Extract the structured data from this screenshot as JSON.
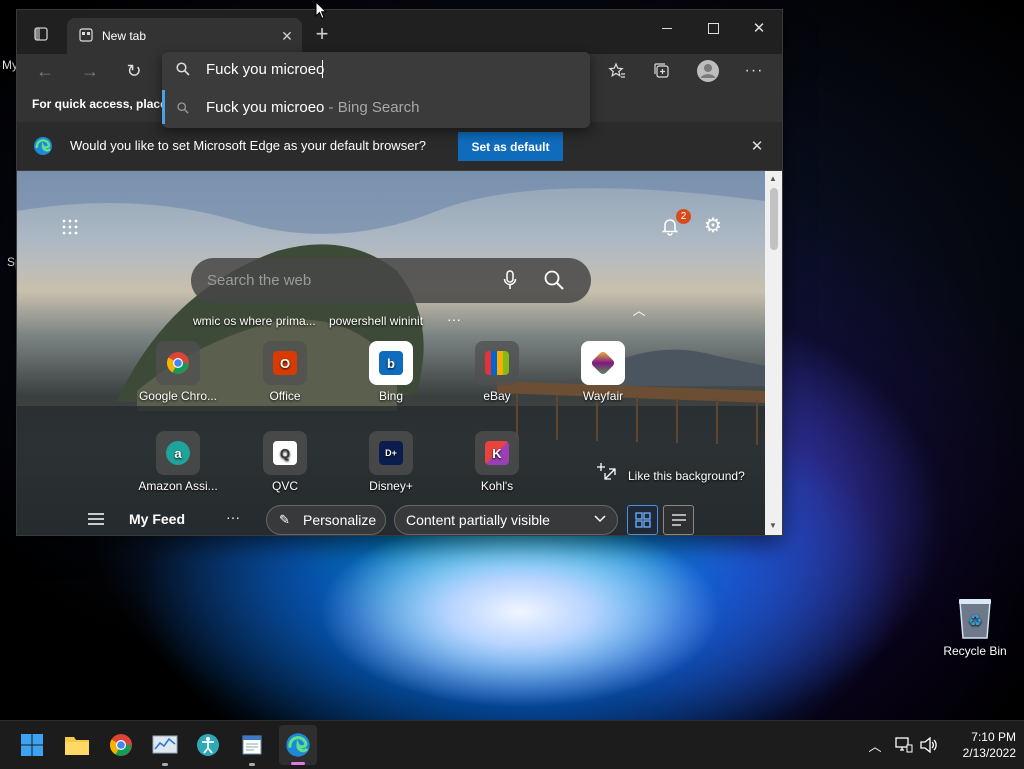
{
  "desktop": {
    "clip_top": "My",
    "clip_mid": "Sp",
    "recycle_label": "Recycle Bin"
  },
  "browser": {
    "tab_title": "New tab",
    "address_value": "Fuck you microeo",
    "suggestion_query": "Fuck you microeo",
    "suggestion_source": " - Bing Search",
    "favbar_text": "For quick access, place y",
    "infobar_text": "Would you like to set Microsoft Edge as your default browser?",
    "set_default_label": "Set as default"
  },
  "newtab": {
    "notification_count": "2",
    "search_placeholder": "Search the web",
    "recent_searches": [
      "wmic os where prima...",
      "powershell wininit"
    ],
    "more_dots": "···",
    "tiles": [
      {
        "label": "Google Chro...",
        "icon": "chrome-icon"
      },
      {
        "label": "Office",
        "icon": "office-icon"
      },
      {
        "label": "Bing",
        "icon": "bing-icon"
      },
      {
        "label": "eBay",
        "icon": "ebay-icon"
      },
      {
        "label": "Wayfair",
        "icon": "wayfair-icon"
      },
      {
        "label": "Amazon Assi...",
        "icon": "amazon-icon"
      },
      {
        "label": "QVC",
        "icon": "qvc-icon"
      },
      {
        "label": "Disney+",
        "icon": "disney-icon"
      },
      {
        "label": "Kohl's",
        "icon": "kohls-icon"
      }
    ],
    "like_background": "Like this background?",
    "my_feed": "My Feed",
    "personalize": "Personalize",
    "content_visibility": "Content partially visible"
  },
  "taskbar": {
    "time": "7:10 PM",
    "date": "2/13/2022"
  },
  "colors": {
    "accent": "#0f6cbd",
    "badge": "#d94a1a"
  }
}
